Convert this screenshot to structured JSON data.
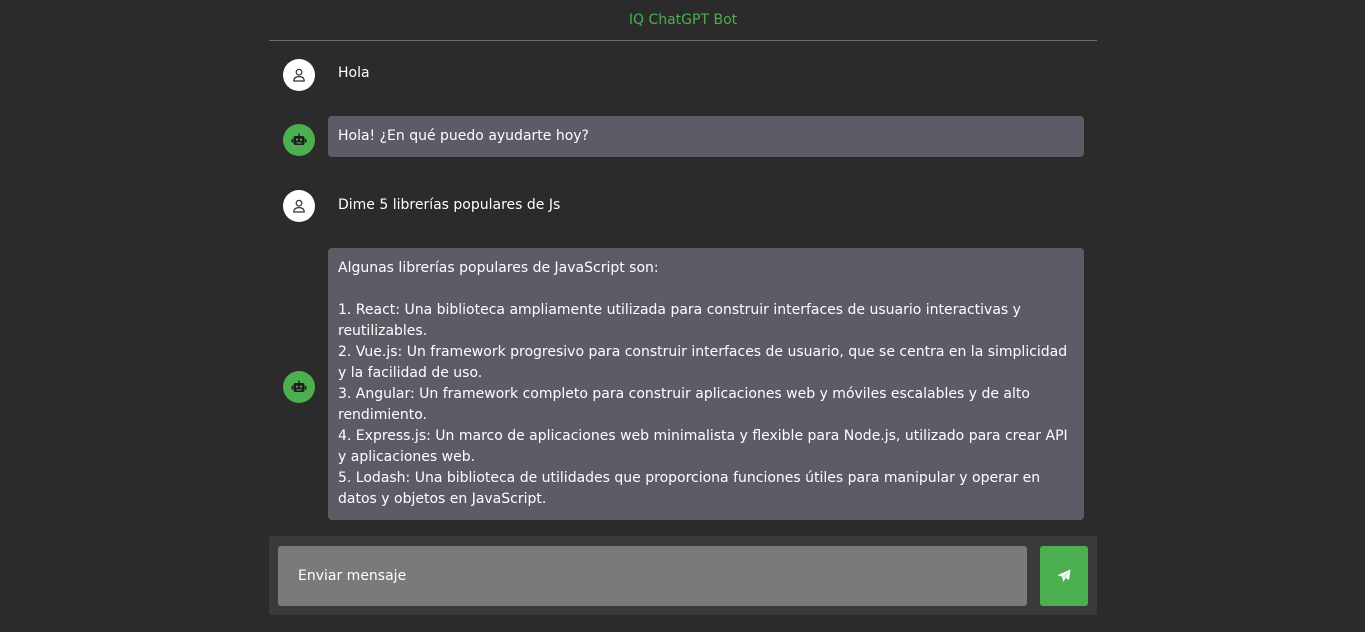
{
  "header": {
    "title": "IQ ChatGPT Bot"
  },
  "messages": [
    {
      "role": "user",
      "avatar_icon": "user-icon",
      "text": "Hola"
    },
    {
      "role": "bot",
      "avatar_icon": "robot-icon",
      "text": "Hola! ¿En qué puedo ayudarte hoy?"
    },
    {
      "role": "user",
      "avatar_icon": "user-icon",
      "text": "Dime 5 librerías populares de Js"
    },
    {
      "role": "bot",
      "avatar_icon": "robot-icon",
      "text": "Algunas librerías populares de JavaScript son:\n\n1. React: Una biblioteca ampliamente utilizada para construir interfaces de usuario interactivas y reutilizables.\n2. Vue.js: Un framework progresivo para construir interfaces de usuario, que se centra en la simplicidad y la facilidad de uso.\n3. Angular: Un framework completo para construir aplicaciones web y móviles escalables y de alto rendimiento.\n4. Express.js: Un marco de aplicaciones web minimalista y flexible para Node.js, utilizado para crear API y aplicaciones web.\n5. Lodash: Una biblioteca de utilidades que proporciona funciones útiles para manipular y operar en datos y objetos en JavaScript."
    }
  ],
  "composer": {
    "placeholder": "Enviar mensaje",
    "send_icon": "send-icon"
  },
  "colors": {
    "accent": "#4caf50",
    "background": "#2b2b2b",
    "bot_bubble": "#5c5c66",
    "input": "#7a7a7a"
  }
}
